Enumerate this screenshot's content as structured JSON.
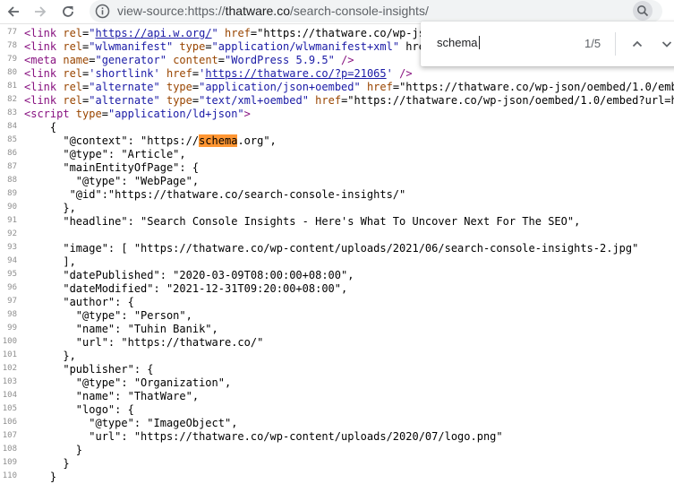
{
  "browser": {
    "url_scheme": "view-source:https://",
    "url_host": "thatware.co",
    "url_path": "/search-console-insights/"
  },
  "find": {
    "query": "schema",
    "count": "1/5"
  },
  "source_lines": [
    {
      "n": "77",
      "text": "<link rel=\"https://api.w.org/\" href=\"https://thatware.co/wp-jso"
    },
    {
      "n": "78",
      "text": "<link rel=\"wlwmanifest\" type=\"application/wlwmanifest+xml\" href"
    },
    {
      "n": "79",
      "text": "<meta name=\"generator\" content=\"WordPress 5.9.5\" />"
    },
    {
      "n": "80",
      "text": "<link rel='shortlink' href='https://thatware.co/?p=21065' />"
    },
    {
      "n": "81",
      "text": "<link rel=\"alternate\" type=\"application/json+oembed\" href=\"https://thatware.co/wp-json/oembed/1.0/embe"
    },
    {
      "n": "82",
      "text": "<link rel=\"alternate\" type=\"text/xml+oembed\" href=\"https://thatware.co/wp-json/oembed/1.0/embed?url=ht"
    },
    {
      "n": "83",
      "text": "<script type=\"application/ld+json\">"
    },
    {
      "n": "84",
      "text": "    {"
    },
    {
      "n": "85",
      "text": "      \"@context\": \"https://schema.org\","
    },
    {
      "n": "86",
      "text": "      \"@type\": \"Article\","
    },
    {
      "n": "87",
      "text": "      \"mainEntityOfPage\": {"
    },
    {
      "n": "88",
      "text": "        \"@type\": \"WebPage\","
    },
    {
      "n": "89",
      "text": "       \"@id\":\"https://thatware.co/search-console-insights/\""
    },
    {
      "n": "90",
      "text": "      },"
    },
    {
      "n": "91",
      "text": "      \"headline\": \"Search Console Insights - Here's What To Uncover Next For The SEO\","
    },
    {
      "n": "92",
      "text": ""
    },
    {
      "n": "93",
      "text": "      \"image\": [ \"https://thatware.co/wp-content/uploads/2021/06/search-console-insights-2.jpg\""
    },
    {
      "n": "94",
      "text": "      ],"
    },
    {
      "n": "95",
      "text": "      \"datePublished\": \"2020-03-09T08:00:00+08:00\","
    },
    {
      "n": "96",
      "text": "      \"dateModified\": \"2021-12-31T09:20:00+08:00\","
    },
    {
      "n": "97",
      "text": "      \"author\": {"
    },
    {
      "n": "98",
      "text": "        \"@type\": \"Person\","
    },
    {
      "n": "99",
      "text": "        \"name\": \"Tuhin Banik\","
    },
    {
      "n": "100",
      "text": "        \"url\": \"https://thatware.co/\""
    },
    {
      "n": "101",
      "text": "      },"
    },
    {
      "n": "102",
      "text": "      \"publisher\": {"
    },
    {
      "n": "103",
      "text": "        \"@type\": \"Organization\","
    },
    {
      "n": "104",
      "text": "        \"name\": \"ThatWare\","
    },
    {
      "n": "105",
      "text": "        \"logo\": {"
    },
    {
      "n": "106",
      "text": "          \"@type\": \"ImageObject\","
    },
    {
      "n": "107",
      "text": "          \"url\": \"https://thatware.co/wp-content/uploads/2020/07/logo.png\""
    },
    {
      "n": "108",
      "text": "        }"
    },
    {
      "n": "109",
      "text": "      }"
    },
    {
      "n": "110",
      "text": "    }"
    }
  ],
  "colors": {
    "tag": "#881280",
    "attribute": "#994500",
    "value": "#1a1aa6",
    "match_highlight": "#ff9632",
    "line_number": "#8f8f8f"
  },
  "icons": {
    "back": "arrow-left-icon",
    "forward": "arrow-right-icon",
    "reload": "reload-icon",
    "info": "info-icon",
    "zoom": "zoom-icon",
    "prev": "chevron-up-icon",
    "next": "chevron-down-icon"
  }
}
